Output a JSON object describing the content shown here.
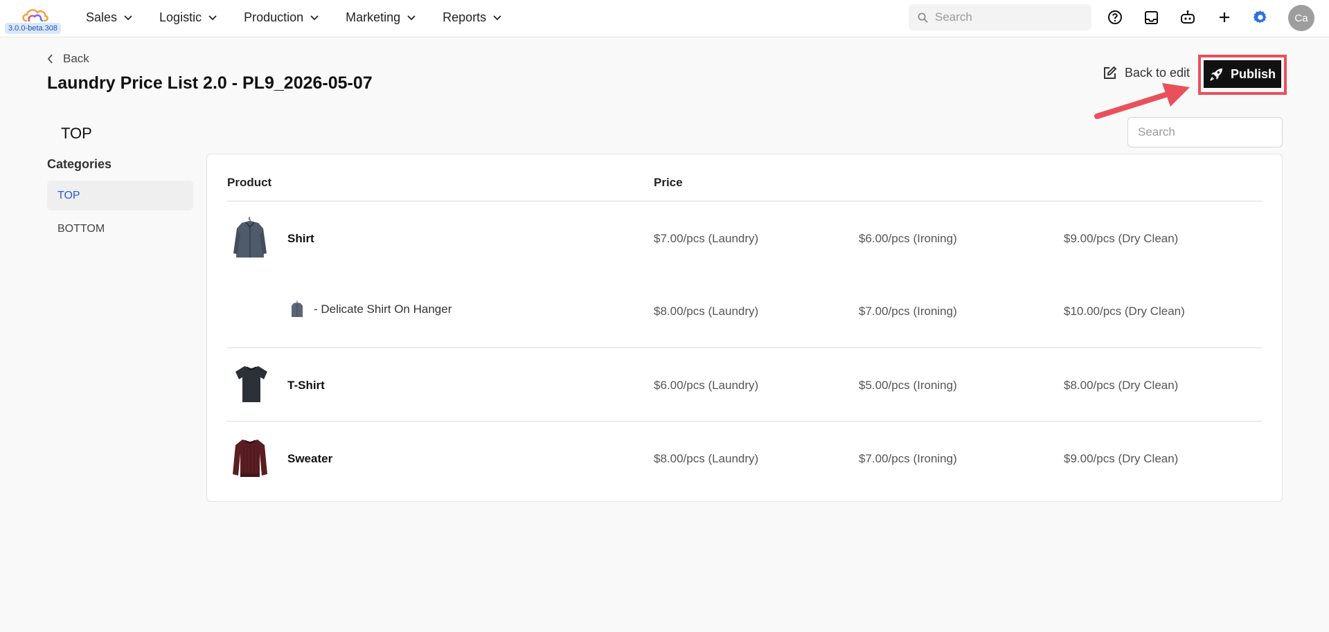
{
  "app": {
    "version": "3.0.0-beta.308",
    "brand_colors": [
      "#f0a23a",
      "#e9505b",
      "#8a5cf6",
      "#3b82f6"
    ]
  },
  "nav": {
    "items": [
      {
        "label": "Sales"
      },
      {
        "label": "Logistic"
      },
      {
        "label": "Production"
      },
      {
        "label": "Marketing"
      },
      {
        "label": "Reports"
      }
    ],
    "search_placeholder": "Search",
    "icons": [
      "help-icon",
      "inbox-icon",
      "bot-icon",
      "plus-icon",
      "settings-icon"
    ],
    "avatar_initials": "Ca"
  },
  "header": {
    "back_label": "Back",
    "title": "Laundry Price List 2.0 - PL9_2026-05-07",
    "back_to_edit_label": "Back to edit",
    "publish_label": "Publish",
    "highlight_color": "#e9505b"
  },
  "sidebar": {
    "section_title": "TOP",
    "categories_label": "Categories",
    "categories": [
      {
        "label": "TOP",
        "active": true
      },
      {
        "label": "BOTTOM",
        "active": false
      }
    ]
  },
  "table": {
    "search_placeholder": "Search",
    "headers": {
      "product": "Product",
      "price": "Price"
    },
    "rows": [
      {
        "name": "Shirt",
        "image": "shirt-image",
        "prices": [
          "$7.00/pcs (Laundry)",
          "$6.00/pcs (Ironing)",
          "$9.00/pcs (Dry Clean)"
        ],
        "variant": {
          "name": "- Delicate Shirt On Hanger",
          "image": "shirt-hanger-image",
          "prices": [
            "$8.00/pcs (Laundry)",
            "$7.00/pcs (Ironing)",
            "$10.00/pcs (Dry Clean)"
          ]
        }
      },
      {
        "name": "T-Shirt",
        "image": "tshirt-image",
        "prices": [
          "$6.00/pcs (Laundry)",
          "$5.00/pcs (Ironing)",
          "$8.00/pcs (Dry Clean)"
        ]
      },
      {
        "name": "Sweater",
        "image": "sweater-image",
        "prices": [
          "$8.00/pcs (Laundry)",
          "$7.00/pcs (Ironing)",
          "$9.00/pcs (Dry Clean)"
        ]
      }
    ]
  }
}
